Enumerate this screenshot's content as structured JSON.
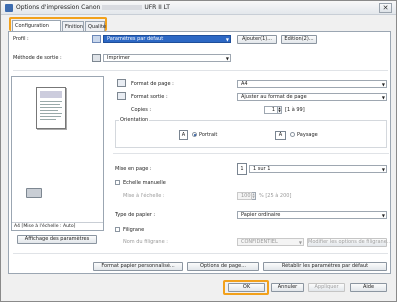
{
  "window": {
    "title_prefix": "Options d'impression Canon",
    "title_suffix": "UFR II LT",
    "close_label": "✕"
  },
  "tabs": [
    {
      "label": "Configuration page"
    },
    {
      "label": "Finition"
    },
    {
      "label": "Qualité"
    }
  ],
  "profile": {
    "label": "Profil :",
    "value": "Paramètres par défaut",
    "add_label": "Ajouter(1)...",
    "edit_label": "Edition(2)..."
  },
  "output": {
    "label": "Méthode de sortie :",
    "value": "Imprimer"
  },
  "page": {
    "format_label": "Format de page :",
    "format_value": "A4",
    "output_format_label": "Format sortie :",
    "output_format_value": "Ajuster au format de page",
    "copies_label": "Copies :",
    "copies_value": "1",
    "copies_range": "[1 à 99]",
    "orientation_label": "Orientation",
    "portrait_label": "Portrait",
    "landscape_label": "Paysage",
    "layout_label": "Mise en page :",
    "layout_value": "1 sur 1",
    "layout_num": "1",
    "manual_scale_label": "Echelle manuelle",
    "scale_label": "Mise à l'échelle :",
    "scale_value": "100",
    "scale_range": "% [25 à 200]",
    "paper_type_label": "Type de papier :",
    "paper_type_value": "Papier ordinaire",
    "watermark_label": "Filigrane",
    "watermark_name_label": "Nom du filigrane :",
    "watermark_value": "CONFIDENTIEL",
    "watermark_edit_label": "Modifier les options de filigrane..."
  },
  "preview": {
    "caption": "A4 [Mise à l'échelle : Auto]",
    "show_settings_label": "Affichage des paramètres"
  },
  "bottom_buttons": {
    "custom_paper": "Format papier personnalisé...",
    "page_options": "Options de page...",
    "restore": "Rétablir les paramètres par défaut"
  },
  "dialog_buttons": {
    "ok": "OK",
    "cancel": "Annuler",
    "apply": "Appliquer",
    "help": "Aide"
  },
  "colors": {
    "accent": "#f2a11c",
    "selection": "#2d68c4"
  }
}
